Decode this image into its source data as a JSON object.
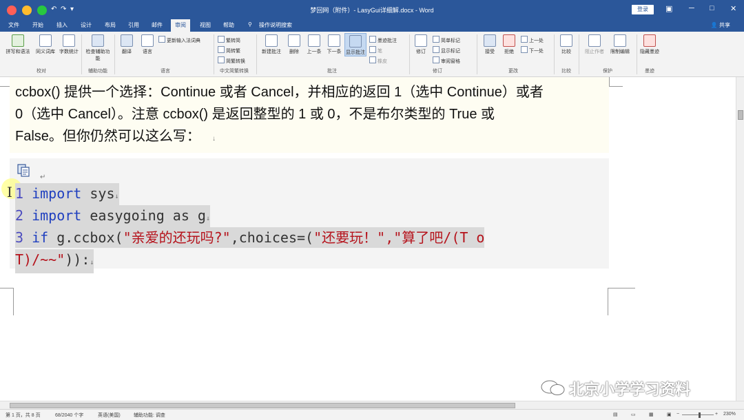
{
  "window": {
    "title": "梦回网（附件）- LasyGui详细解.docx - Word",
    "login_label": "登录",
    "share_label": "共享",
    "qa_undo": "↶",
    "qa_redo": "↷",
    "qa_customize": "▾"
  },
  "tabs": [
    {
      "label": "文件"
    },
    {
      "label": "开始"
    },
    {
      "label": "插入"
    },
    {
      "label": "设计"
    },
    {
      "label": "布局"
    },
    {
      "label": "引用"
    },
    {
      "label": "邮件"
    },
    {
      "label": "审阅"
    },
    {
      "label": "视图"
    },
    {
      "label": "帮助"
    },
    {
      "label": "操作说明搜索"
    }
  ],
  "active_tab": "审阅",
  "ribbon": {
    "proofing": {
      "group": "校对",
      "spelling": "拼写和语法",
      "thesaurus": "同义词库",
      "word_count": "字数统计",
      "abc": "ABC 123"
    },
    "accessibility": {
      "group": "辅助功能",
      "check": "检查辅助功能"
    },
    "language": {
      "group": "语言",
      "translate": "翻译",
      "language": "语言",
      "update_ime": "更新输入法词典"
    },
    "chinese": {
      "group": "中文简繁转换",
      "to_simplified": "繁转简",
      "to_traditional": "简转繁",
      "convert": "简繁转换"
    },
    "comments": {
      "group": "批注",
      "new": "新建批注",
      "delete": "删除",
      "prev": "上一条",
      "next": "下一条",
      "show": "显示批注",
      "ink": "墨迹批注",
      "ink2": "笔",
      "eraser": "橡皮"
    },
    "tracking": {
      "group": "修订",
      "track": "修订",
      "simple_markup": "简单标记",
      "show_markup": "显示标记",
      "review_pane": "审阅窗格"
    },
    "changes": {
      "group": "更改",
      "accept": "接受",
      "reject": "拒绝",
      "prev": "上一处",
      "next": "下一处"
    },
    "compare": {
      "group": "比较",
      "compare": "比较"
    },
    "protect": {
      "group": "保护",
      "block_authors": "阻止作者",
      "restrict": "限制编辑"
    },
    "ink": {
      "group": "墨迹",
      "hide_ink": "隐藏墨迹"
    }
  },
  "document": {
    "para_lines": [
      "ccbox() 提供一个选择：Continue 或者 Cancel，并相应的返回 1（选中 Continue）或者",
      "0（选中 Cancel）。注意 ccbox() 是返回整型的 1 或 0，不是布尔类型的 True 或",
      "False。但你仍然可以这么写："
    ],
    "para_end": "↓",
    "code": [
      {
        "num": "1",
        "kw": "import",
        "rest": " sys",
        "end": "↓"
      },
      {
        "num": "2",
        "kw": "import",
        "rest": " easygoing as g",
        "end": "↓"
      },
      {
        "num": "3",
        "kw": "if",
        "rest": " g.ccbox(",
        "str1": "\"亲爱的还玩吗?\"",
        "rest2": ",choices=(",
        "str2": "\"还要玩！\",\"算了吧/(T o",
        "end": ""
      },
      {
        "cont": "T)/~~\"",
        "rest": ")):",
        "end": "↓"
      }
    ],
    "code_mark": "↵"
  },
  "status_bar": {
    "page": "第 1 页，共 8 页",
    "words": "68/2040 个字",
    "lang": "英语(美国)",
    "accessibility": "辅助功能: 调查",
    "zoom": "230%"
  },
  "watermark": "北京小学学习资料"
}
